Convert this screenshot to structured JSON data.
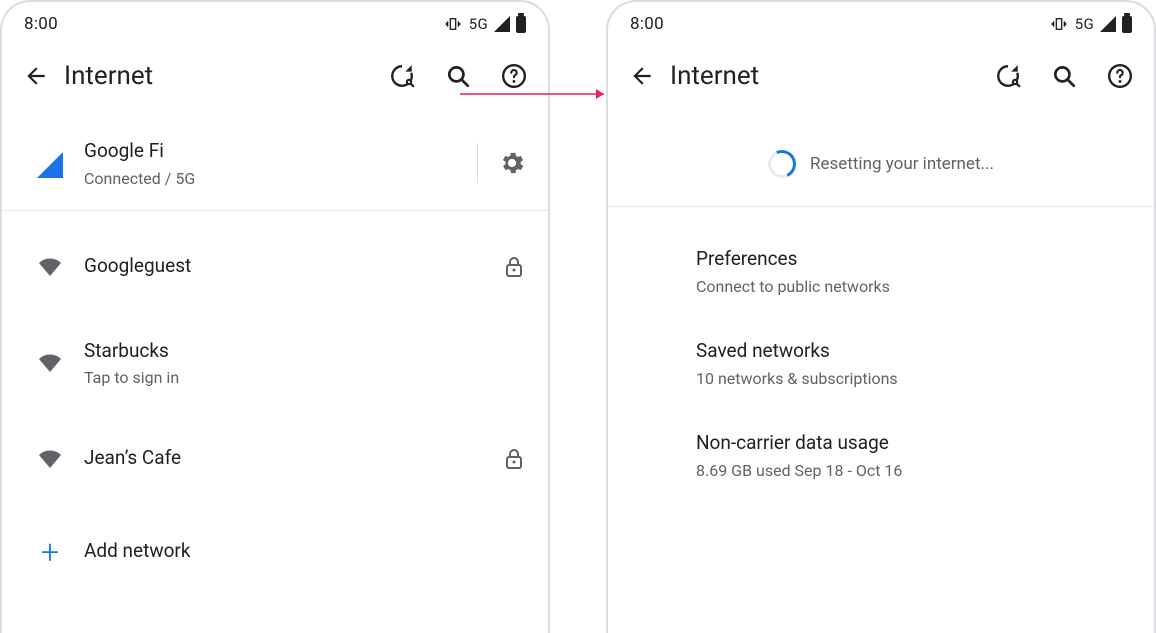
{
  "status": {
    "time": "8:00",
    "network_label": "5G"
  },
  "appbar": {
    "title": "Internet"
  },
  "screen1": {
    "carrier": {
      "name": "Google Fi",
      "status": "Connected / 5G"
    },
    "wifi": [
      {
        "name": "Googleguest",
        "sub": "",
        "locked": true
      },
      {
        "name": "Starbucks",
        "sub": "Tap to sign in",
        "locked": false
      },
      {
        "name": "Jean’s Cafe",
        "sub": "",
        "locked": true
      }
    ],
    "add_label": "Add network"
  },
  "screen2": {
    "banner": "Resetting your internet...",
    "settings": [
      {
        "title": "Preferences",
        "sub": "Connect to public networks"
      },
      {
        "title": "Saved networks",
        "sub": "10 networks & subscriptions"
      },
      {
        "title": "Non-carrier data usage",
        "sub": "8.69 GB used Sep 18 - Oct 16"
      }
    ]
  }
}
